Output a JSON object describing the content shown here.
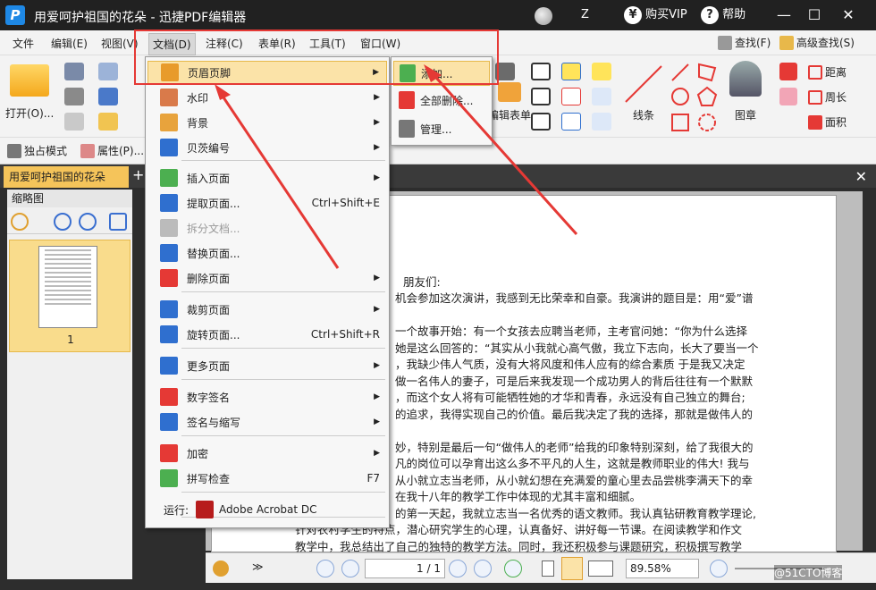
{
  "window": {
    "title": "用爱呵护祖国的花朵 - 迅捷PDF编辑器",
    "logo": "P",
    "user": "Z",
    "vip": "购买VIP",
    "help": "帮助"
  },
  "menubar": {
    "items": [
      "文件",
      "编辑(E)",
      "视图(V)",
      "文档(D)",
      "注释(C)",
      "表单(R)",
      "工具(T)",
      "窗口(W)"
    ],
    "find": "查找(F)",
    "advanced_find": "高级查找(S)"
  },
  "toolbar": {
    "open": "打开(O)...",
    "edit_form": "编辑表单",
    "line": "线条",
    "stamp": "图章",
    "distance": "距离",
    "perimeter": "周长",
    "area": "面积",
    "exclusive": "独占模式",
    "properties": "属性(P)..."
  },
  "tab": {
    "label": "用爱呵护祖国的花朵"
  },
  "side": {
    "header": "缩略图",
    "page_num": "1"
  },
  "doc_menu": [
    {
      "label": "页眉页脚",
      "shortcut": "",
      "arrow": true,
      "color": "#e89b2b",
      "disabled": false,
      "highlight": true
    },
    {
      "label": "水印",
      "shortcut": "",
      "arrow": true,
      "color": "#d97a4a",
      "disabled": false
    },
    {
      "label": "背景",
      "shortcut": "",
      "arrow": true,
      "color": "#e8a33c",
      "disabled": false
    },
    {
      "label": "贝茨编号",
      "shortcut": "",
      "arrow": true,
      "color": "#2f6fcf",
      "disabled": false
    },
    {
      "label": "插入页面",
      "shortcut": "",
      "arrow": true,
      "color": "#4caf50",
      "disabled": false
    },
    {
      "label": "提取页面...",
      "shortcut": "Ctrl+Shift+E",
      "arrow": false,
      "color": "#2f6fcf",
      "disabled": false
    },
    {
      "label": "拆分文档...",
      "shortcut": "",
      "arrow": false,
      "color": "#bbbbbb",
      "disabled": true
    },
    {
      "label": "替换页面...",
      "shortcut": "",
      "arrow": false,
      "color": "#2f6fcf",
      "disabled": false
    },
    {
      "label": "删除页面",
      "shortcut": "",
      "arrow": true,
      "color": "#e53935",
      "disabled": false
    },
    {
      "label": "裁剪页面",
      "shortcut": "",
      "arrow": true,
      "color": "#2f6fcf",
      "disabled": false
    },
    {
      "label": "旋转页面...",
      "shortcut": "Ctrl+Shift+R",
      "arrow": false,
      "color": "#2f6fcf",
      "disabled": false
    },
    {
      "label": "更多页面",
      "shortcut": "",
      "arrow": true,
      "color": "#2f6fcf",
      "disabled": false
    },
    {
      "label": "数字签名",
      "shortcut": "",
      "arrow": true,
      "color": "#e53935",
      "disabled": false
    },
    {
      "label": "签名与缩写",
      "shortcut": "",
      "arrow": true,
      "color": "#2f6fcf",
      "disabled": false
    },
    {
      "label": "加密",
      "shortcut": "",
      "arrow": true,
      "color": "#e53935",
      "disabled": false
    },
    {
      "label": "拼写检查",
      "shortcut": "F7",
      "arrow": false,
      "color": "#4caf50",
      "disabled": false
    }
  ],
  "run_with": {
    "label": "运行:",
    "app": "Adobe Acrobat DC"
  },
  "submenu": [
    {
      "label": "添加...",
      "color": "#4caf50"
    },
    {
      "label": "全部删除...",
      "color": "#e53935"
    },
    {
      "label": "管理...",
      "color": "#777777"
    }
  ],
  "document": {
    "greeting": "朋友们:",
    "lines": [
      "机会参加这次演讲，我感到无比荣幸和自豪。我演讲的题目是：用“爱”谱",
      "",
      "一个故事开始：有一个女孩去应聘当老师，主考官问她：“你为什么选择",
      "她是这么回答的：“其实从小我就心高气傲，我立下志向，长大了要当一个",
      "，我缺少伟人气质，没有大将风度和伟人应有的综合素质 于是我又决定",
      "做一名伟人的妻子，可是后来我发现一个成功男人的背后往往有一个默默",
      "，而这个女人将有可能牺牲她的才华和青春，永远没有自己独立的舞台;",
      "的追求，我得实现自己的价值。最后我决定了我的选择，那就是做伟人的",
      "",
      "妙，特别是最后一句“做伟人的老师”给我的印象特别深刻，给了我很大的",
      "凡的岗位可以孕育出这么多不平凡的人生，这就是教师职业的伟大! 我与",
      "从小就立志当老师，从小就幻想在充满爱的童心里去品尝桃李满天下的幸",
      "在我十八年的教学工作中体现的尤其丰富和细腻。",
      "的第一天起，我就立志当一名优秀的语文教师。我认真钻研教育教学理论,",
      "针对农村学生的特点，潜心研究学生的心理，认真备好、讲好每一节课。在阅读教学和作文",
      "教学中，我总结出了自己的独特的教学方法。同时，我还积极参与课题研究，积极撰写教学"
    ]
  },
  "status": {
    "page": "1 / 1",
    "zoom": "89.58%"
  },
  "watermark": "@51CTO博客"
}
